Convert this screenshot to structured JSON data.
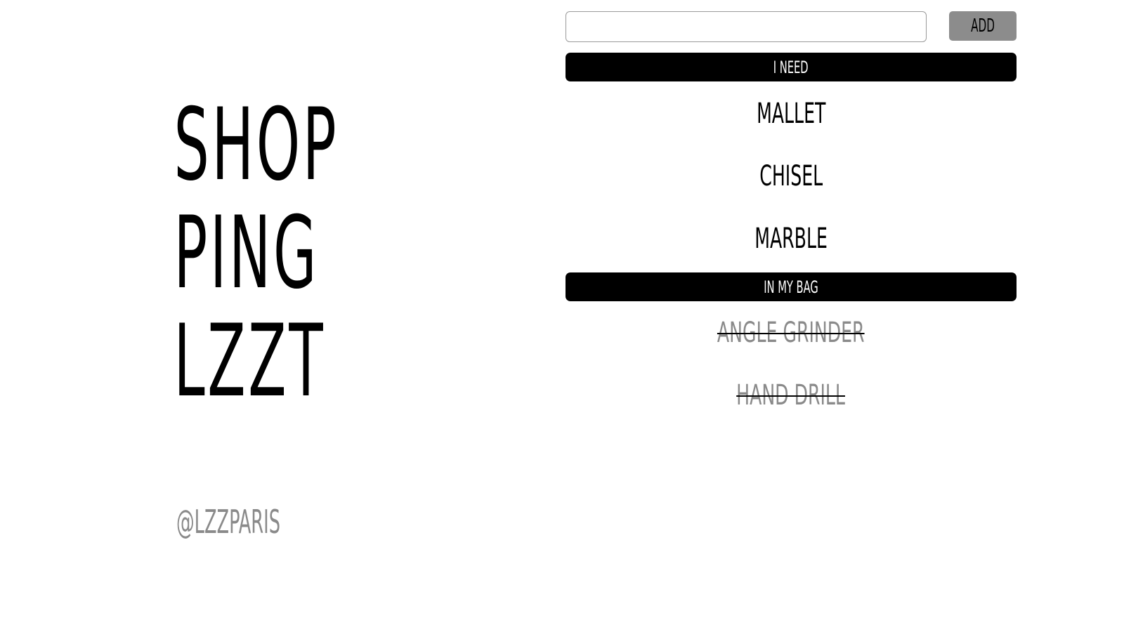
{
  "brand": {
    "line1": "SHOP",
    "line2": "PING",
    "line3": "LZZT",
    "handle": "@LZZPARIS"
  },
  "form": {
    "input_value": "",
    "input_placeholder": "",
    "add_label": "ADD"
  },
  "sections": {
    "need_title": "I NEED",
    "bag_title": "IN MY BAG"
  },
  "need_items": [
    {
      "label": "MALLET"
    },
    {
      "label": "CHISEL"
    },
    {
      "label": "MARBLE"
    }
  ],
  "bag_items": [
    {
      "label": "ANGLE GRINDER"
    },
    {
      "label": "HAND DRILL"
    }
  ],
  "colors": {
    "background": "#ffffff",
    "text": "#000000",
    "muted": "#8a8a8a",
    "section_bar": "#000000",
    "add_button": "#8c8c8c"
  }
}
